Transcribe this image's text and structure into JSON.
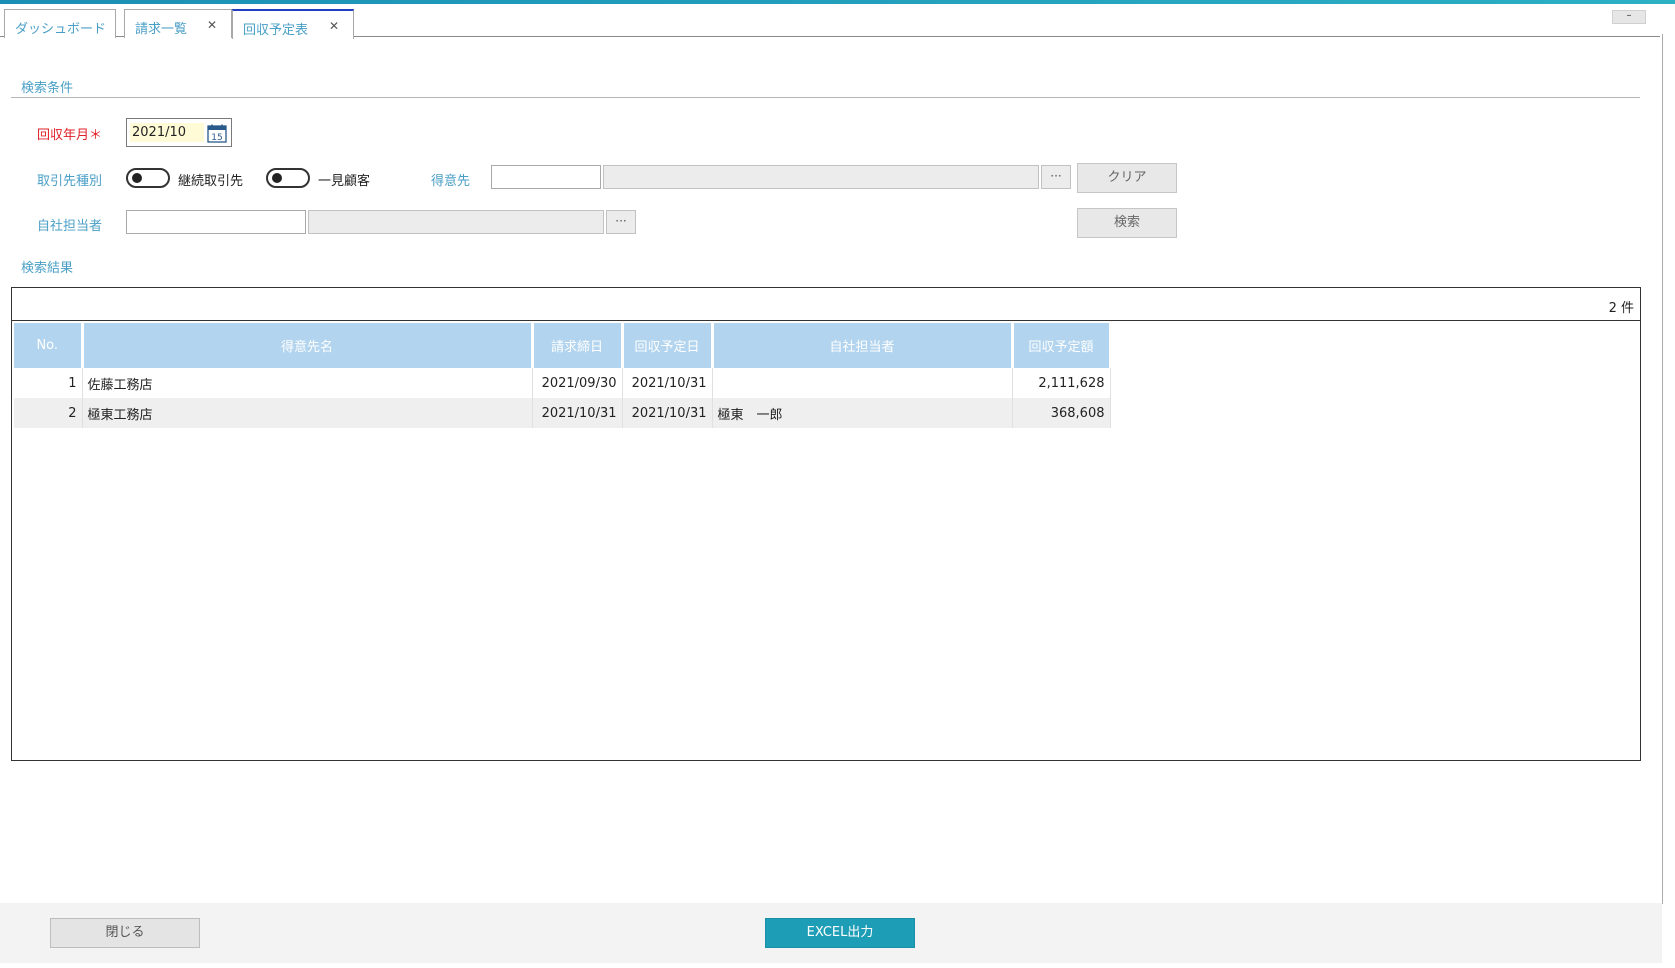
{
  "colors": {
    "accent": "#4a9fc6",
    "required": "#e0202a",
    "header": "#b2d4ee",
    "excel": "#1e9db7"
  },
  "tabs": [
    {
      "label": "ダッシュボード",
      "closable": false
    },
    {
      "label": "請求一覧",
      "closable": true
    },
    {
      "label": "回収予定表",
      "closable": true,
      "active": true
    }
  ],
  "window": {
    "minimize": "–"
  },
  "search": {
    "section_title": "検索条件",
    "year_month_label": "回収年月",
    "required_mark": "＊",
    "year_month_value": "2021/10",
    "partner_type_label": "取引先種別",
    "toggle_continuous": "継続取引先",
    "toggle_onetime": "一見顧客",
    "customer_label": "得意先",
    "customer_code": "",
    "customer_name": "",
    "dots": "···",
    "clear_button": "クリア",
    "staff_label": "自社担当者",
    "staff_code": "",
    "staff_name": "",
    "search_button": "検索"
  },
  "results": {
    "section_title": "検索結果",
    "count": "2 件",
    "columns": [
      "No.",
      "得意先名",
      "請求締日",
      "回収予定日",
      "自社担当者",
      "回収予定額"
    ],
    "rows": [
      {
        "no": "1",
        "customer": "佐藤工務店",
        "closing_date": "2021/09/30",
        "collection_date": "2021/10/31",
        "staff": "",
        "amount": "2,111,628"
      },
      {
        "no": "2",
        "customer": "極東工務店",
        "closing_date": "2021/10/31",
        "collection_date": "2021/10/31",
        "staff": "極東　一郎",
        "amount": "368,608"
      }
    ]
  },
  "footer": {
    "close_button": "閉じる",
    "excel_button": "EXCEL出力"
  }
}
